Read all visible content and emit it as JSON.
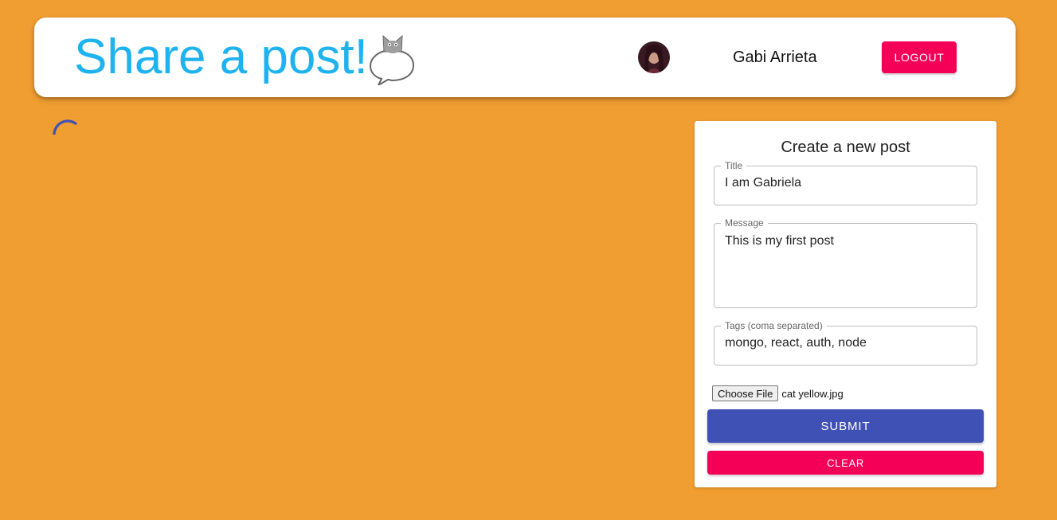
{
  "header": {
    "title": "Share a post!",
    "logo_icon": "cat-speech-bubble-icon",
    "user_name": "Gabi Arrieta",
    "logout_label": "LOGOUT"
  },
  "colors": {
    "background": "#f09d31",
    "title": "#1eb3ee",
    "primary": "#3f51b5",
    "secondary": "#f50057"
  },
  "posts": {
    "loading_icon": "spinner-icon"
  },
  "form": {
    "heading": "Create a new post",
    "title_label": "Title",
    "title_value": "I am Gabriela",
    "message_label": "Message",
    "message_value": "This is my first post",
    "tags_label": "Tags (coma separated)",
    "tags_value": "mongo, react, auth, node",
    "file_button_label": "Choose File",
    "file_name": "cat yellow.jpg",
    "submit_label": "SUBMIT",
    "clear_label": "CLEAR"
  }
}
